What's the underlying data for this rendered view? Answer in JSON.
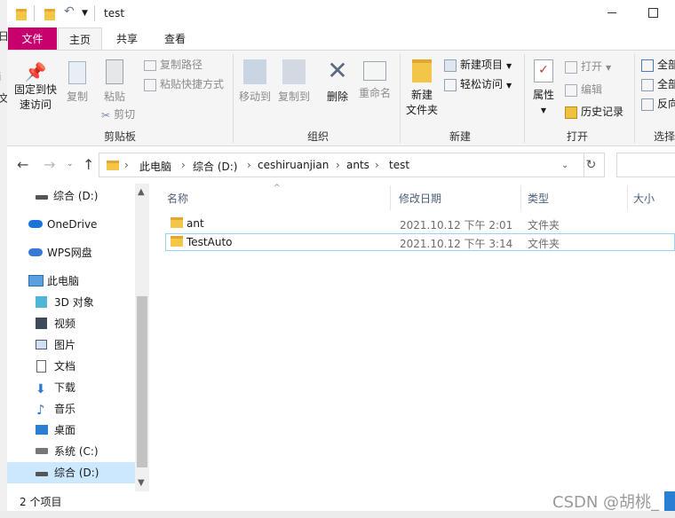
{
  "window": {
    "title": "test",
    "left_strip_chars": [
      "日",
      "i",
      "文"
    ]
  },
  "ribbon_tabs": [
    "文件",
    "主页",
    "共享",
    "查看"
  ],
  "ribbon": {
    "pin_label_1": "固定到快",
    "pin_label_2": "速访问",
    "copy": "复制",
    "paste": "粘贴",
    "copy_path": "复制路径",
    "paste_shortcut": "粘贴快捷方式",
    "cut": "剪切",
    "clipboard_group": "剪贴板",
    "move_to": "移动到",
    "copy_to": "复制到",
    "delete": "删除",
    "rename": "重命名",
    "organize_group": "组织",
    "new_folder_1": "新建",
    "new_folder_2": "文件夹",
    "new_item": "新建项目",
    "easy_access": "轻松访问",
    "new_group": "新建",
    "properties": "属性",
    "open": "打开",
    "edit": "编辑",
    "history": "历史记录",
    "open_group": "打开",
    "select_all": "全部",
    "select_none": "全部",
    "invert": "反向",
    "select_group": "选择"
  },
  "address": {
    "crumbs": [
      "此电脑",
      "综合 (D:)",
      "ceshiruanjian",
      "ants",
      "test"
    ]
  },
  "nav": {
    "items": [
      "综合 (D:)",
      "OneDrive",
      "WPS网盘",
      "此电脑",
      "3D 对象",
      "视频",
      "图片",
      "文档",
      "下载",
      "音乐",
      "桌面",
      "系统 (C:)",
      "综合 (D:)"
    ]
  },
  "columns": [
    "名称",
    "修改日期",
    "类型",
    "大小"
  ],
  "files": [
    {
      "name": "ant",
      "date": "2021.10.12 下午 2:01",
      "type": "文件夹"
    },
    {
      "name": "TestAuto",
      "date": "2021.10.12 下午 3:14",
      "type": "文件夹"
    }
  ],
  "status": {
    "count": "2 个项目"
  },
  "watermark": "CSDN @胡桃_"
}
